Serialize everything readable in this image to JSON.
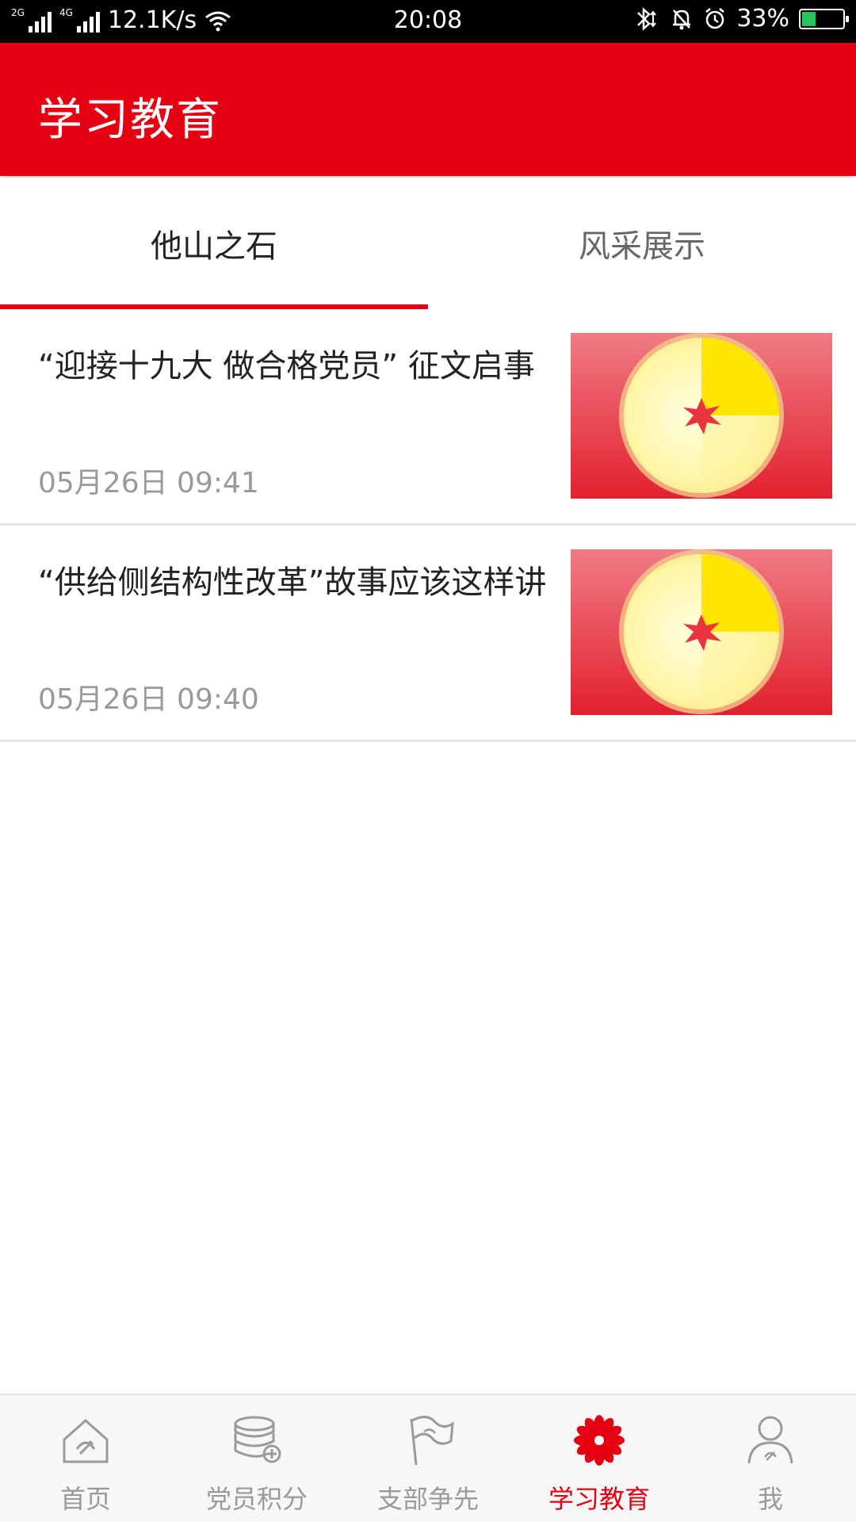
{
  "status_bar": {
    "network_2g": "2G",
    "network_4g": "4G",
    "speed": "12.1K/s",
    "time": "20:08",
    "battery": "33%",
    "battery_level": 0.33
  },
  "header": {
    "title": "学习教育"
  },
  "tabs": [
    {
      "label": "他山之石",
      "active": true
    },
    {
      "label": "风采展示",
      "active": false
    }
  ],
  "news": [
    {
      "title": "“迎接十九大 做合格党员” 征文启事",
      "time": "05月26日 09:41",
      "thumb": "party-emblem-thumbnail"
    },
    {
      "title": "“供给侧结构性改革”故事应该这样讲",
      "time": "05月26日 09:40",
      "thumb": "party-emblem-thumbnail"
    }
  ],
  "bottom_nav": [
    {
      "label": "首页",
      "icon": "home-icon",
      "active": false
    },
    {
      "label": "党员积分",
      "icon": "points-stack-icon",
      "active": false
    },
    {
      "label": "支部争先",
      "icon": "flag-icon",
      "active": false
    },
    {
      "label": "学习教育",
      "icon": "flower-icon",
      "active": true
    },
    {
      "label": "我",
      "icon": "profile-icon",
      "active": false
    }
  ],
  "colors": {
    "brand": "#e60012",
    "inactive": "#9a9a9a"
  }
}
